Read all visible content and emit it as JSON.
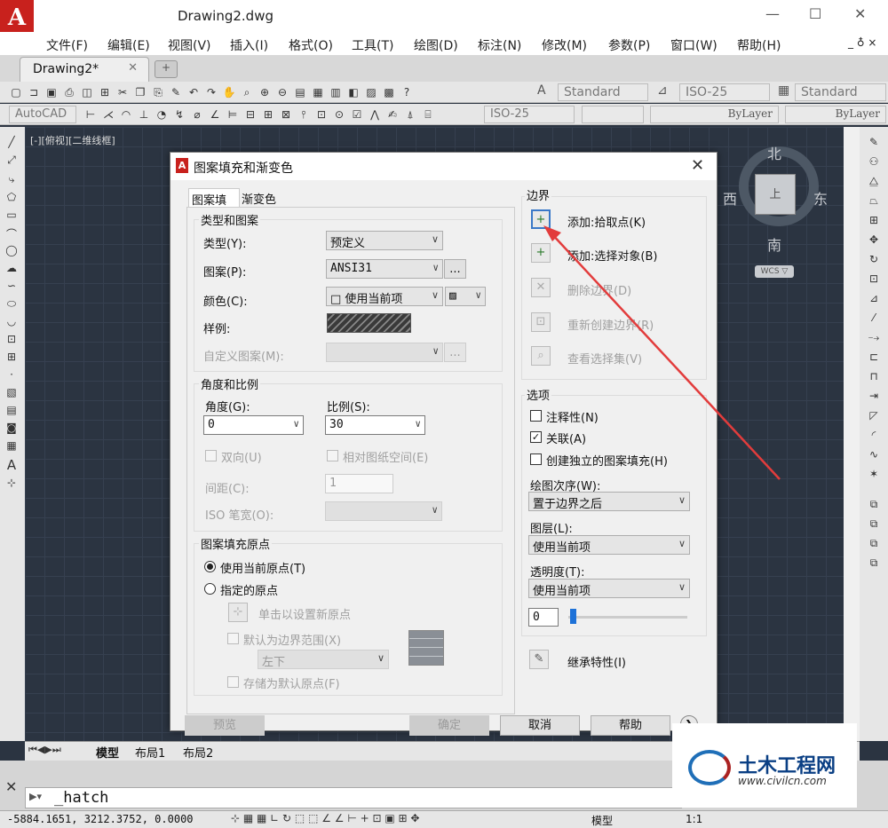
{
  "app": {
    "logo": "A",
    "title": "Drawing2.dwg"
  },
  "window_controls": {
    "minimize": "—",
    "maximize": "☐",
    "close": "✕"
  },
  "menu": [
    "文件(F)",
    "编辑(E)",
    "视图(V)",
    "插入(I)",
    "格式(O)",
    "工具(T)",
    "绘图(D)",
    "标注(N)",
    "修改(M)",
    "参数(P)",
    "窗口(W)",
    "帮助(H)"
  ],
  "menu_controls": "_ ♁ ×",
  "tabs": {
    "doc": "Drawing2*",
    "close": "✕",
    "new": "+"
  },
  "toolbar1": {
    "text_style": "Standard",
    "dim_style": "ISO-25",
    "table_style": "Standard"
  },
  "toolbar2": {
    "workspace": "AutoCAD",
    "dim_style": "ISO-25",
    "color": "",
    "linetype": "ByLayer",
    "lineweight": "ByLayer"
  },
  "viewport_label": "[-][俯视][二维线框]",
  "viewcube": {
    "n": "北",
    "s": "南",
    "w": "西",
    "e": "东",
    "face": "上",
    "wcs": "WCS ▽"
  },
  "layout_tabs": [
    "模型",
    "布局1",
    "布局2"
  ],
  "command": {
    "prompt": "▶▾",
    "text": "_hatch"
  },
  "status": {
    "coords": "-5884.1651, 3212.3752, 0.0000",
    "model": "模型",
    "scale": "1:1"
  },
  "dialog": {
    "title": "图案填充和渐变色",
    "close": "✕",
    "tabs": [
      "图案填充",
      "渐变色"
    ],
    "type_pattern": {
      "group": "类型和图案",
      "type_label": "类型(Y):",
      "type_value": "预定义",
      "pattern_label": "图案(P):",
      "pattern_value": "ANSI31",
      "color_label": "颜色(C):",
      "color_value": "□ 使用当前项",
      "color2_value": "▨",
      "sample_label": "样例:",
      "custom_label": "自定义图案(M):",
      "browse": "..."
    },
    "angle_scale": {
      "group": "角度和比例",
      "angle_label": "角度(G):",
      "angle_value": "0",
      "scale_label": "比例(S):",
      "scale_value": "30",
      "double_label": "双向(U)",
      "relative_label": "相对图纸空间(E)",
      "spacing_label": "间距(C):",
      "spacing_value": "1",
      "iso_label": "ISO 笔宽(O):"
    },
    "origin": {
      "group": "图案填充原点",
      "use_current": "使用当前原点(T)",
      "specified": "指定的原点",
      "click_set": "单击以设置新原点",
      "default_extent": "默认为边界范围(X)",
      "position": "左下",
      "store_default": "存储为默认原点(F)"
    },
    "boundary": {
      "group": "边界",
      "add_pick": "添加:拾取点(K)",
      "add_select": "添加:选择对象(B)",
      "remove": "删除边界(D)",
      "recreate": "重新创建边界(R)",
      "view_sel": "查看选择集(V)"
    },
    "options": {
      "group": "选项",
      "annotative": "注释性(N)",
      "associative": "关联(A)",
      "separate": "创建独立的图案填充(H)",
      "draw_order_label": "绘图次序(W):",
      "draw_order": "置于边界之后",
      "layer_label": "图层(L):",
      "layer": "使用当前项",
      "transparency_label": "透明度(T):",
      "transparency": "使用当前项",
      "transparency_value": "0"
    },
    "inherit": "继承特性(I)",
    "buttons": {
      "preview": "预览",
      "ok": "确定",
      "cancel": "取消",
      "help": "帮助"
    }
  },
  "watermark": {
    "brand": "土木工程网",
    "url": "www.civilcn.com"
  },
  "colors": {
    "accent": "#c8211d",
    "annotation_arrow": "#e23c3c",
    "canvas": "#2b3441"
  }
}
